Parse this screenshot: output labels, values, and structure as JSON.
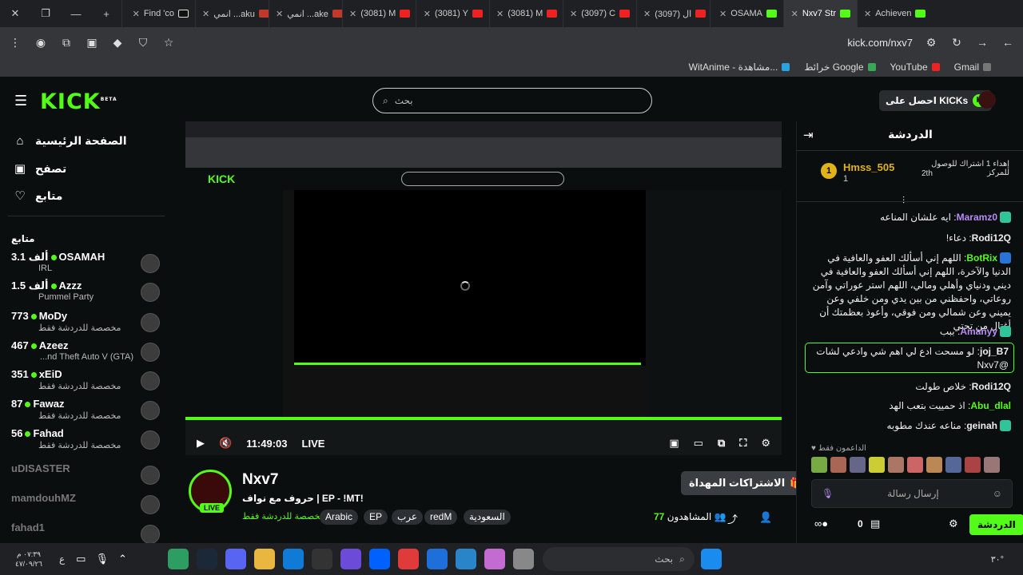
{
  "browser": {
    "tabs": [
      {
        "label": "Find 'co",
        "icon": "tiktok-icon"
      },
      {
        "label": "انمي ...aku",
        "icon": "anime-icon"
      },
      {
        "label": "انمي ...ake",
        "icon": "anime-icon"
      },
      {
        "label": "(3081) M",
        "icon": "youtube-icon"
      },
      {
        "label": "(3081) Y",
        "icon": "youtube-icon"
      },
      {
        "label": "(3081) M",
        "icon": "youtube-icon"
      },
      {
        "label": "(3097) C",
        "icon": "youtube-icon"
      },
      {
        "label": "(3097) ال",
        "icon": "youtube-icon"
      },
      {
        "label": "OSAMA",
        "icon": "kick-icon"
      },
      {
        "label": "Nxv7 Str",
        "icon": "kick-icon",
        "active": true
      },
      {
        "label": "Achieven",
        "icon": "kick-icon"
      }
    ],
    "url": "kick.com/nxv7",
    "bookmarks": [
      {
        "label": "Gmail"
      },
      {
        "label": "YouTube"
      },
      {
        "label": "خرائط Google"
      },
      {
        "label": "WitAnime - مشاهدة..."
      }
    ]
  },
  "header": {
    "logo": "KICK",
    "logo_sup": "BETA",
    "search_placeholder": "بحث",
    "get_kicks": "احصل على KICKs"
  },
  "sidebar": {
    "nav": [
      {
        "label": "الصفحة الرئيسية",
        "icon": "home-icon"
      },
      {
        "label": "تصفح",
        "icon": "browse-icon"
      },
      {
        "label": "متابع",
        "icon": "heart-icon"
      }
    ],
    "following_heading": "متابع",
    "channels": [
      {
        "viewers": "3.1 ألف",
        "name": "OSAMAH",
        "category": "IRL",
        "live": true
      },
      {
        "viewers": "1.5 ألف",
        "name": "Azzz",
        "category": "Pummel Party",
        "live": true
      },
      {
        "viewers": "773",
        "name": "MoDy",
        "category": "مخصصة للدردشة فقط",
        "live": true
      },
      {
        "viewers": "467",
        "name": "Azeez",
        "category": "...nd Theft Auto V (GTA)",
        "live": true
      },
      {
        "viewers": "351",
        "name": "xEiD",
        "category": "مخصصة للدردشة فقط",
        "live": true
      },
      {
        "viewers": "87",
        "name": "Fawaz",
        "category": "مخصصة للدردشة فقط",
        "live": true
      },
      {
        "viewers": "56",
        "name": "Fahad",
        "category": "مخصصة للدردشة فقط",
        "live": true
      },
      {
        "name": "uDISASTER",
        "live": false
      },
      {
        "name": "mamdouhMZ",
        "live": false
      },
      {
        "name": "fahad1",
        "live": false
      }
    ]
  },
  "player": {
    "time": "11:49:03",
    "live": "LIVE"
  },
  "stream": {
    "streamer": "Nxv7",
    "live_badge": "LIVE",
    "title": "حروف مع نواف | EP - !MT!",
    "category": "مخصصة للدردشة فقط",
    "tags": [
      "Arabic",
      "EP",
      "عرب",
      "redM",
      "السعودية"
    ],
    "subs_button": "الاشتراكات المهداة",
    "viewers_label": "المشاهدون",
    "viewers_count": "77"
  },
  "chat": {
    "title": "الدردشة",
    "pinned_user": "Hmss_505",
    "pinned_rank": "1",
    "pinned_count": "1",
    "pinned_text": "إهداء 1 اشتراك للوصول للمركز",
    "pinned_place": "2th",
    "messages": [
      {
        "user": "Maramz0",
        "text": "ايه علشان المناعه",
        "color": "#b98cf6"
      },
      {
        "user": "Rodi12Q",
        "text": "دعاء!",
        "color": "#fff"
      },
      {
        "user": "BotRix",
        "text": "اللهم إني أسألك العفو والعافية في الدنيا والآخرة، اللهم إني أسألك العفو والعافية في ديني ودنياي وأهلي ومالي، اللهم استر عوراتي وآمن روعاتي، واحفظني من بين يدي ومن خلفي وعن يميني وعن شمالي ومن فوقي، وأعوذ بعظمتك أن أغتال من تحتي",
        "color": "#53fc18"
      },
      {
        "user": "Amanyy",
        "text": "ببب",
        "color": "#b98cf6"
      },
      {
        "user": "joj_B7",
        "text": "لو مسحت ادع لي اهم شي وادعي لشات @Nxv7",
        "color": "#fff"
      },
      {
        "user": "Rodi12Q",
        "text": "خلاص طولت",
        "color": "#fff"
      },
      {
        "user": "Abu_dlal",
        "text": "اذ حمييت بتعب الهد",
        "color": "#53fc18"
      },
      {
        "user": "geinah",
        "text": "مناعه عندك مطوبه",
        "color": "#fff"
      }
    ],
    "supporters_label": "الداعمون فقط",
    "input_placeholder": "إرسال رسالة",
    "kicks_count": "0",
    "send_label": "الدردشة"
  },
  "taskbar": {
    "search_placeholder": "بحث",
    "clock_time": "٠٧:٣٩ م",
    "clock_date": "٤٧/٠٩/٢٦",
    "lang": "ع",
    "temp": "٣٠°"
  }
}
